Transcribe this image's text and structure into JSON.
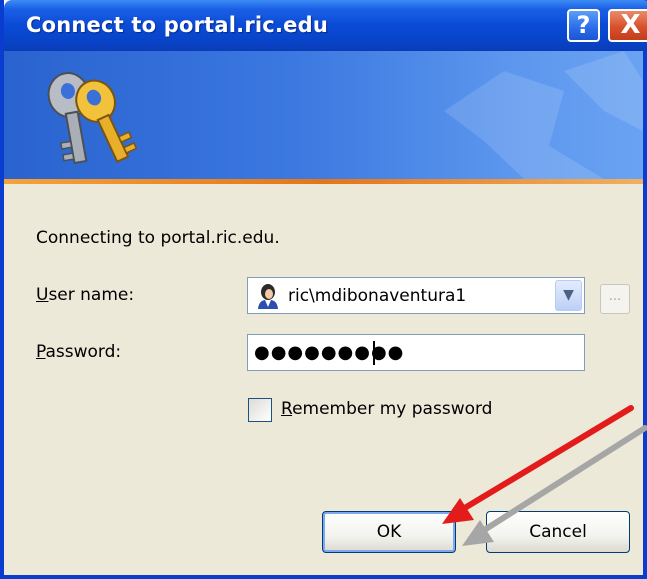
{
  "window": {
    "title": "Connect to portal.ric.edu"
  },
  "title_buttons": {
    "help": "?",
    "close": "X"
  },
  "dialog": {
    "message": "Connecting to portal.ric.edu.",
    "username": {
      "label": "User name:",
      "value": "ric\\mdibonaventura1",
      "browse_label": "..."
    },
    "password": {
      "label": "Password:",
      "masked_value": "●●●●●●●●●"
    },
    "remember": {
      "label": "Remember my password",
      "checked": false
    },
    "ok_label": "OK",
    "cancel_label": "Cancel"
  },
  "annotations": {
    "arrow_colors": [
      "#e31b1b",
      "#a6a6a6"
    ]
  }
}
